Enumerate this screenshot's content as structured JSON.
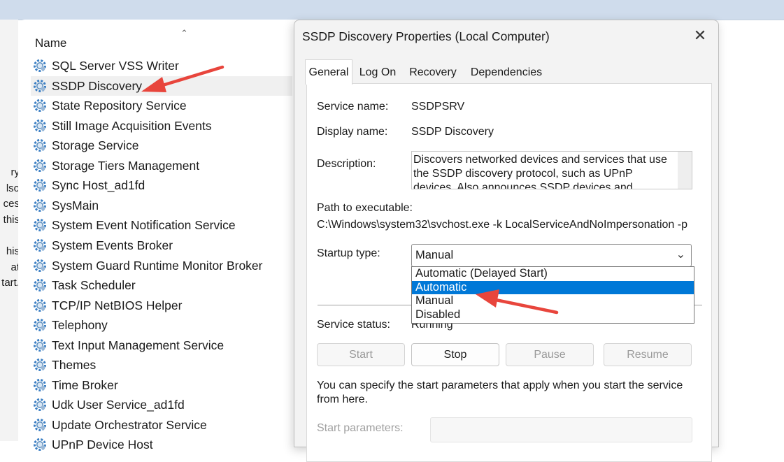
{
  "service_list": {
    "column_header": "Name",
    "sort_indicator": "^",
    "description_fragment": [
      "ry",
      "lso",
      "ces",
      "this",
      "",
      "his",
      "at",
      "tart."
    ],
    "items": [
      {
        "name": "SQL Server VSS Writer",
        "selected": false
      },
      {
        "name": "SSDP Discovery",
        "selected": true
      },
      {
        "name": "State Repository Service",
        "selected": false
      },
      {
        "name": "Still Image Acquisition Events",
        "selected": false
      },
      {
        "name": "Storage Service",
        "selected": false
      },
      {
        "name": "Storage Tiers Management",
        "selected": false
      },
      {
        "name": "Sync Host_ad1fd",
        "selected": false
      },
      {
        "name": "SysMain",
        "selected": false
      },
      {
        "name": "System Event Notification Service",
        "selected": false
      },
      {
        "name": "System Events Broker",
        "selected": false
      },
      {
        "name": "System Guard Runtime Monitor Broker",
        "selected": false
      },
      {
        "name": "Task Scheduler",
        "selected": false
      },
      {
        "name": "TCP/IP NetBIOS Helper",
        "selected": false
      },
      {
        "name": "Telephony",
        "selected": false
      },
      {
        "name": "Text Input Management Service",
        "selected": false
      },
      {
        "name": "Themes",
        "selected": false
      },
      {
        "name": "Time Broker",
        "selected": false
      },
      {
        "name": "Udk User Service_ad1fd",
        "selected": false
      },
      {
        "name": "Update Orchestrator Service",
        "selected": false
      },
      {
        "name": "UPnP Device Host",
        "selected": false
      }
    ],
    "icon": "service-gear-icon"
  },
  "dialog": {
    "title": "SSDP Discovery Properties (Local Computer)",
    "close_glyph": "✕",
    "tabs": [
      "General",
      "Log On",
      "Recovery",
      "Dependencies"
    ],
    "active_tab": "General",
    "service_name_label": "Service name:",
    "service_name_value": "SSDPSRV",
    "display_name_label": "Display name:",
    "display_name_value": "SSDP Discovery",
    "description_label": "Description:",
    "description_value": "Discovers networked devices and services that use the SSDP discovery protocol, such as UPnP devices. Also announces SSDP devices and services running",
    "path_label": "Path to executable:",
    "path_value": "C:\\Windows\\system32\\svchost.exe -k LocalServiceAndNoImpersonation -p",
    "startup_type_label": "Startup type:",
    "startup_type_value": "Manual",
    "startup_options": [
      "Automatic (Delayed Start)",
      "Automatic",
      "Manual",
      "Disabled"
    ],
    "highlighted_option": "Automatic",
    "service_status_label": "Service status:",
    "service_status_value": "Running",
    "buttons": {
      "start": "Start",
      "stop": "Stop",
      "pause": "Pause",
      "resume": "Resume"
    },
    "start_params_info": "You can specify the start parameters that apply when you start the service from here.",
    "start_params_label": "Start parameters:"
  },
  "colors": {
    "selection_highlight": "#0078d7",
    "annotation_arrow": "#e8453c",
    "service_icon": "#3b7fc4"
  }
}
